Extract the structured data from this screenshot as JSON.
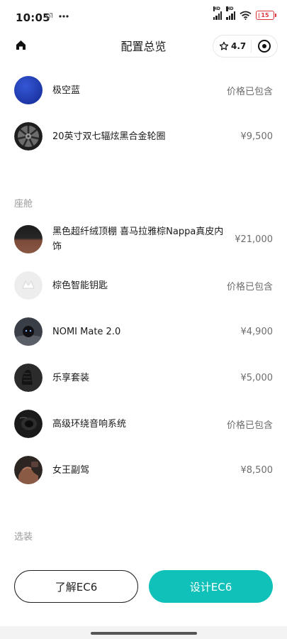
{
  "status": {
    "time": "10:05",
    "battery": "15",
    "battery_level": 0.15,
    "network_label": "HD",
    "icons": [
      "gallery-icon",
      "more-dots-icon",
      "signal-icon",
      "wifi-icon",
      "battery-icon"
    ]
  },
  "header": {
    "title": "配置总览",
    "rating": "4.7",
    "icons": [
      "home-icon",
      "star-icon",
      "target-icon"
    ]
  },
  "items_top": [
    {
      "name": "极空蓝",
      "price": "价格已包含",
      "icon": "color-swatch-blue"
    },
    {
      "name": "20英寸双七辐炫黑合金轮圈",
      "price": "¥9,500",
      "icon": "wheel-rim"
    }
  ],
  "section_cabin": {
    "title": "座舱",
    "items": [
      {
        "name": "黑色超纤绒顶棚 喜马拉雅棕Nappa真皮内饰",
        "price": "¥21,000",
        "icon": "interior-swatch"
      },
      {
        "name": "棕色智能钥匙",
        "price": "价格已包含",
        "icon": "smart-key"
      },
      {
        "name": "NOMI Mate 2.0",
        "price": "¥4,900",
        "icon": "nomi-device"
      },
      {
        "name": "乐享套装",
        "price": "¥5,000",
        "icon": "seat-package"
      },
      {
        "name": "高级环绕音响系统",
        "price": "价格已包含",
        "icon": "speaker"
      },
      {
        "name": "女王副驾",
        "price": "¥8,500",
        "icon": "passenger-seat"
      }
    ]
  },
  "section_options": {
    "title": "选装"
  },
  "buttons": {
    "learn": "了解EC6",
    "design": "设计EC6"
  },
  "colors": {
    "accent": "#10c1b9",
    "swatch_blue": "#1f3fb8"
  }
}
